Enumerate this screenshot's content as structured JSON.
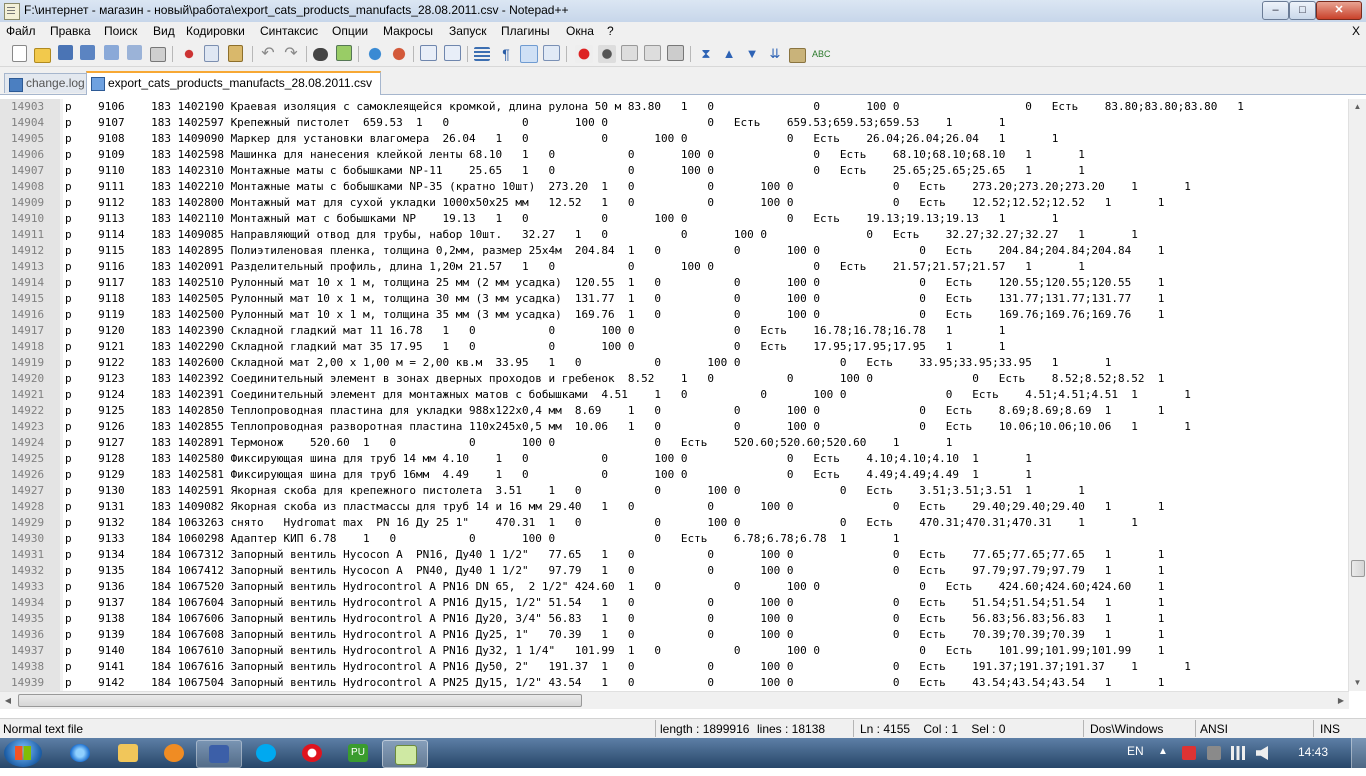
{
  "window": {
    "title": "F:\\интернет - магазин  - новый\\работа\\export_cats_products_manufacts_28.08.2011.csv - Notepad++",
    "minimize_glyph": "‒",
    "maximize_glyph": "□",
    "close_glyph": "✕"
  },
  "menu": {
    "items": [
      "Файл",
      "Правка",
      "Поиск",
      "Вид",
      "Кодировки",
      "Синтаксис",
      "Опции",
      "Макросы",
      "Запуск",
      "Плагины",
      "Окна",
      "?"
    ],
    "close_glyph": "X"
  },
  "toolbar": {
    "buttons": [
      "new-file",
      "open-file",
      "save",
      "save-all",
      "close",
      "close-all",
      "print",
      "cut",
      "copy",
      "paste",
      "undo",
      "redo",
      "find",
      "replace",
      "zoom-in",
      "zoom-out",
      "sync-vertical",
      "sync-horizontal",
      "word-wrap",
      "show-all-chars",
      "indent-guide",
      "user-defined-language",
      "record-macro",
      "stop-record",
      "play-macro",
      "run-macro-multiple",
      "save-macro",
      "spell-check"
    ],
    "active_button": "indent-guide"
  },
  "tabs": [
    {
      "label": "change.log",
      "active": false
    },
    {
      "label": "export_cats_products_manufacts_28.08.2011.csv",
      "active": true
    }
  ],
  "editor": {
    "lines": [
      {
        "num": "14903",
        "text": "р    9106    183 1402190 Краевая изоляция с самоклеящейся кромкой, длина рулона 50 м 83.80   1   0               0       100 0                   0   Есть    83.80;83.80;83.80   1"
      },
      {
        "num": "14904",
        "text": "р    9107    183 1402597 Крепежный пистолет  659.53  1   0           0       100 0               0   Есть    659.53;659.53;659.53    1       1"
      },
      {
        "num": "14905",
        "text": "р    9108    183 1409090 Маркер для установки влагомера  26.04   1   0           0       100 0               0   Есть    26.04;26.04;26.04   1       1"
      },
      {
        "num": "14906",
        "text": "р    9109    183 1402598 Машинка для нанесения клейкой ленты 68.10   1   0           0       100 0               0   Есть    68.10;68.10;68.10   1       1"
      },
      {
        "num": "14907",
        "text": "р    9110    183 1402310 Монтажные маты с бобышками NP-11    25.65   1   0           0       100 0               0   Есть    25.65;25.65;25.65   1       1"
      },
      {
        "num": "14908",
        "text": "р    9111    183 1402210 Монтажные маты с бобышками NP-35 (кратно 10шт)  273.20  1   0           0       100 0               0   Есть    273.20;273.20;273.20    1       1"
      },
      {
        "num": "14909",
        "text": "р    9112    183 1402800 Монтажный мат для сухой укладки 1000x50x25 мм   12.52   1   0           0       100 0               0   Есть    12.52;12.52;12.52   1       1"
      },
      {
        "num": "14910",
        "text": "р    9113    183 1402110 Монтажный мат с бобышками NP    19.13   1   0           0       100 0               0   Есть    19.13;19.13;19.13   1       1"
      },
      {
        "num": "14911",
        "text": "р    9114    183 1409085 Направляющий отвод для трубы, набор 10шт.   32.27   1   0           0       100 0               0   Есть    32.27;32.27;32.27   1       1"
      },
      {
        "num": "14912",
        "text": "р    9115    183 1402895 Полиэтиленовая пленка, толщина 0,2мм, размер 25x4м  204.84  1   0           0       100 0               0   Есть    204.84;204.84;204.84    1"
      },
      {
        "num": "14913",
        "text": "р    9116    183 1402091 Разделительный профиль, длина 1,20м 21.57   1   0           0       100 0               0   Есть    21.57;21.57;21.57   1       1"
      },
      {
        "num": "14914",
        "text": "р    9117    183 1402510 Рулонный мат 10 х 1 м, толщина 25 мм (2 мм усадка)  120.55  1   0           0       100 0               0   Есть    120.55;120.55;120.55    1"
      },
      {
        "num": "14915",
        "text": "р    9118    183 1402505 Рулонный мат 10 х 1 м, толщина 30 мм (3 мм усадка)  131.77  1   0           0       100 0               0   Есть    131.77;131.77;131.77    1"
      },
      {
        "num": "14916",
        "text": "р    9119    183 1402500 Рулонный мат 10 х 1 м, толщина 35 мм (3 мм усадка)  169.76  1   0           0       100 0               0   Есть    169.76;169.76;169.76    1"
      },
      {
        "num": "14917",
        "text": "р    9120    183 1402390 Складной гладкий мат 11 16.78   1   0           0       100 0               0   Есть    16.78;16.78;16.78   1       1"
      },
      {
        "num": "14918",
        "text": "р    9121    183 1402290 Складной гладкий мат 35 17.95   1   0           0       100 0               0   Есть    17.95;17.95;17.95   1       1"
      },
      {
        "num": "14919",
        "text": "р    9122    183 1402600 Складной мат 2,00 х 1,00 м = 2,00 кв.м  33.95   1   0           0       100 0               0   Есть    33.95;33.95;33.95   1       1"
      },
      {
        "num": "14920",
        "text": "р    9123    183 1402392 Соединительный элемент в зонах дверных проходов и гребенок  8.52    1   0           0       100 0               0   Есть    8.52;8.52;8.52  1"
      },
      {
        "num": "14921",
        "text": "р    9124    183 1402391 Соединительный элемент для монтажных матов с бобышками  4.51    1   0           0       100 0               0   Есть    4.51;4.51;4.51  1       1"
      },
      {
        "num": "14922",
        "text": "р    9125    183 1402850 Теплопроводная пластина для укладки 988x122x0,4 мм  8.69    1   0           0       100 0               0   Есть    8.69;8.69;8.69  1       1"
      },
      {
        "num": "14923",
        "text": "р    9126    183 1402855 Теплопроводная разворотная пластина 110x245x0,5 мм  10.06   1   0           0       100 0               0   Есть    10.06;10.06;10.06   1       1"
      },
      {
        "num": "14924",
        "text": "р    9127    183 1402891 Термонож    520.60  1   0           0       100 0               0   Есть    520.60;520.60;520.60    1       1"
      },
      {
        "num": "14925",
        "text": "р    9128    183 1402580 Фиксирующая шина для труб 14 мм 4.10    1   0           0       100 0               0   Есть    4.10;4.10;4.10  1       1"
      },
      {
        "num": "14926",
        "text": "р    9129    183 1402581 Фиксирующая шина для труб 16мм  4.49    1   0           0       100 0               0   Есть    4.49;4.49;4.49  1       1"
      },
      {
        "num": "14927",
        "text": "р    9130    183 1402591 Якорная скоба для крепежного пистолета  3.51    1   0           0       100 0               0   Есть    3.51;3.51;3.51  1       1"
      },
      {
        "num": "14928",
        "text": "р    9131    183 1409082 Якорная скоба из пластмассы для труб 14 и 16 мм 29.40   1   0           0       100 0               0   Есть    29.40;29.40;29.40   1       1"
      },
      {
        "num": "14929",
        "text": "р    9132    184 1063263 снято   Hydromat max  PN 16 Ду 25 1\"    470.31  1   0           0       100 0               0   Есть    470.31;470.31;470.31    1       1"
      },
      {
        "num": "14930",
        "text": "р    9133    184 1060298 Адаптер КИП 6.78    1   0           0       100 0               0   Есть    6.78;6.78;6.78  1       1"
      },
      {
        "num": "14931",
        "text": "р    9134    184 1067312 Запорный вентиль Hycocon A  PN16, Ду40 1 1/2\"   77.65   1   0           0       100 0               0   Есть    77.65;77.65;77.65   1       1"
      },
      {
        "num": "14932",
        "text": "р    9135    184 1067412 Запорный вентиль Hycocon A  PN40, Ду40 1 1/2\"   97.79   1   0           0       100 0               0   Есть    97.79;97.79;97.79   1       1"
      },
      {
        "num": "14933",
        "text": "р    9136    184 1067520 Запорный вентиль Hydrocontrol A PN16 DN 65,  2 1/2\" 424.60  1   0           0       100 0               0   Есть    424.60;424.60;424.60    1"
      },
      {
        "num": "14934",
        "text": "р    9137    184 1067604 Запорный вентиль Hydrocontrol A PN16 Ду15, 1/2\" 51.54   1   0           0       100 0               0   Есть    51.54;51.54;51.54   1       1"
      },
      {
        "num": "14935",
        "text": "р    9138    184 1067606 Запорный вентиль Hydrocontrol A PN16 Ду20, 3/4\" 56.83   1   0           0       100 0               0   Есть    56.83;56.83;56.83   1       1"
      },
      {
        "num": "14936",
        "text": "р    9139    184 1067608 Запорный вентиль Hydrocontrol A PN16 Ду25, 1\"   70.39   1   0           0       100 0               0   Есть    70.39;70.39;70.39   1       1"
      },
      {
        "num": "14937",
        "text": "р    9140    184 1067610 Запорный вентиль Hydrocontrol A PN16 Ду32, 1 1/4\"   101.99  1   0           0       100 0               0   Есть    101.99;101.99;101.99    1"
      },
      {
        "num": "14938",
        "text": "р    9141    184 1067616 Запорный вентиль Hydrocontrol A PN16 Ду50, 2\"   191.37  1   0           0       100 0               0   Есть    191.37;191.37;191.37    1       1"
      },
      {
        "num": "14939",
        "text": "р    9142    184 1067504 Запорный вентиль Hydrocontrol A PN25 Ду15, 1/2\" 43.54   1   0           0       100 0               0   Есть    43.54;43.54;43.54   1       1"
      }
    ]
  },
  "statusbar": {
    "file_type": "Normal text file",
    "length": "length : 1899916",
    "lines": "lines : 18138",
    "cursor": "Ln : 4155    Col : 1    Sel : 0",
    "eol": "Dos\\Windows",
    "encoding": "ANSI",
    "mode": "INS"
  },
  "taskbar": {
    "apps": [
      "internet-explorer",
      "file-explorer",
      "media-player",
      "save-app",
      "skype",
      "opera",
      "pu-app",
      "notepad-plus-plus"
    ],
    "language": "EN",
    "time": "14:43"
  },
  "colors": {
    "line_number": "#808080",
    "gutter": "#e4e4e4",
    "active_tab_accent": "#f7a834",
    "taskbar": "#274669"
  }
}
